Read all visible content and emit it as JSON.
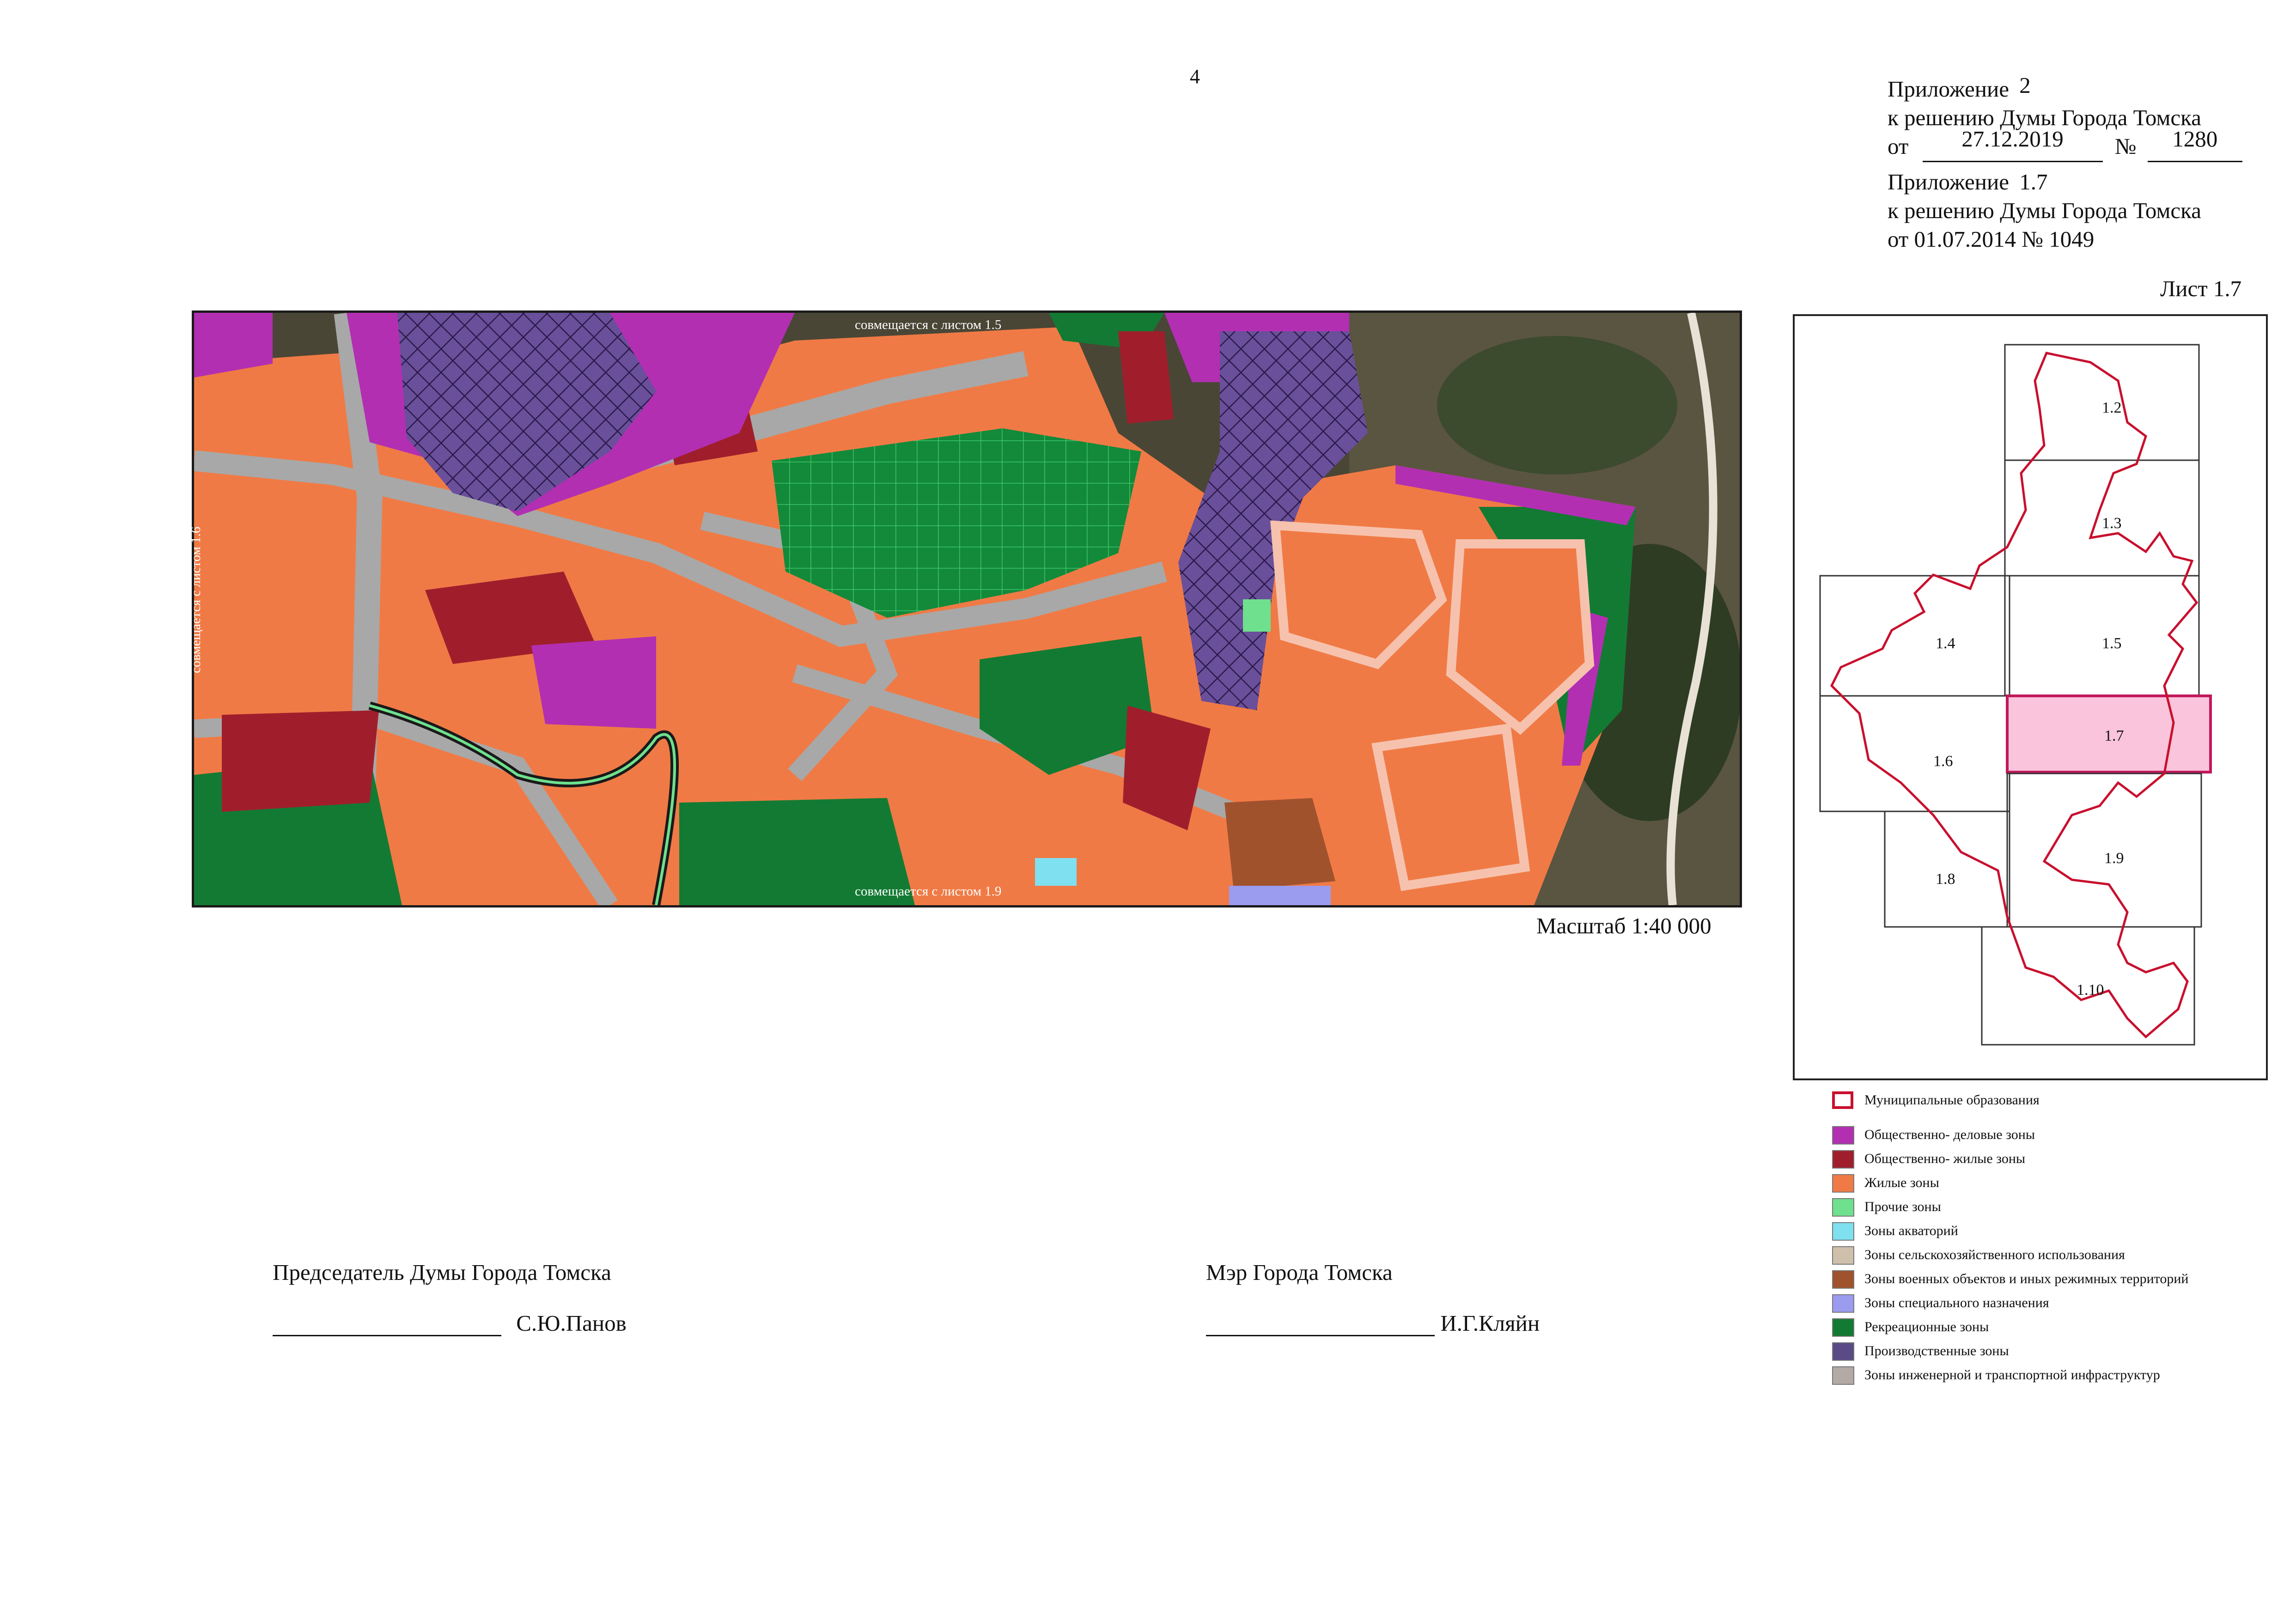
{
  "page_number": "4",
  "header": {
    "app1_label": "Приложение",
    "app1_num": "2",
    "app1_line2": "к решению Думы Города Томска",
    "app1_from": "от",
    "app1_date": "27.12.2019",
    "app1_no_sign": "№",
    "app1_no": "1280",
    "app2_label": "Приложение",
    "app2_num": "1.7",
    "app2_line2": "к решению Думы Города Томска",
    "app2_line3": "от 01.07.2014  № 1049"
  },
  "sheet_label": "Лист  1.7",
  "scale": "Масштаб 1:40 000",
  "map_notes": {
    "top": "совмещается с листом 1.5",
    "bottom": "совмещается с листом 1.9",
    "left": "совмещается с листом 1.6"
  },
  "index_sheets": [
    "1.2",
    "1.3",
    "1.4",
    "1.5",
    "1.6",
    "1.7",
    "1.8",
    "1.9",
    "1.10"
  ],
  "index_highlight": "1.7",
  "legend": {
    "municipal": "Муниципальные образования",
    "items": [
      {
        "label": "Общественно- деловые зоны",
        "color": "#b22fb2"
      },
      {
        "label": "Общественно- жилые зоны",
        "color": "#a01e2c"
      },
      {
        "label": "Жилые зоны",
        "color": "#f07a45"
      },
      {
        "label": "Прочие зоны",
        "color": "#6fe08e"
      },
      {
        "label": "Зоны акваторий",
        "color": "#7fe0f0"
      },
      {
        "label": "Зоны сельскохозяйственного использования",
        "color": "#cfc0ac"
      },
      {
        "label": "Зоны военных объектов и иных  режимных территорий",
        "color": "#a0522d"
      },
      {
        "label": "Зоны специального назначения",
        "color": "#9b9bf0"
      },
      {
        "label": "Рекреационные зоны",
        "color": "#137a33"
      },
      {
        "label": "Производственные зоны",
        "color": "#5a4a86"
      },
      {
        "label": "Зоны инженерной и транспортной инфраструктур",
        "color": "#b3aaa6"
      }
    ]
  },
  "signatures": {
    "left_title": "Председатель Думы Города Томска",
    "left_name": "С.Ю.Панов",
    "right_title": "Мэр Города Томска",
    "right_name": "И.Г.Кляйн"
  }
}
